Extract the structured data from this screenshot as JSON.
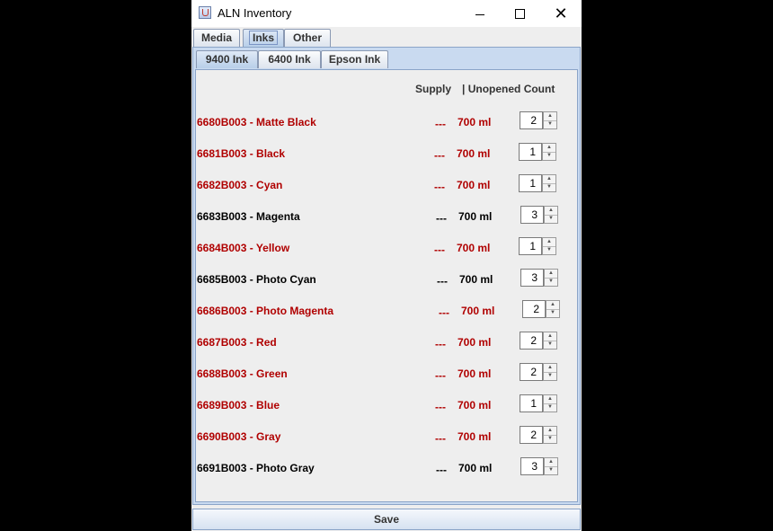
{
  "window": {
    "title": "ALN Inventory",
    "min_icon": "minimize-icon",
    "max_icon": "maximize-icon",
    "close_glyph": "✕"
  },
  "top_tabs": [
    {
      "label": "Media"
    },
    {
      "label": "Inks",
      "selected": true
    },
    {
      "label": "Other"
    }
  ],
  "sub_tabs": [
    {
      "label": "9400 Ink",
      "selected": true
    },
    {
      "label": "6400 Ink"
    },
    {
      "label": "Epson Ink"
    }
  ],
  "headers": {
    "supply": "Supply",
    "count": "| Unopened Count"
  },
  "rows": [
    {
      "name": "6680B003 - Matte Black",
      "supply": "---",
      "volume": "700 ml",
      "count": "2",
      "status": "low"
    },
    {
      "name": "6681B003 - Black",
      "supply": "---",
      "volume": "700 ml",
      "count": "1",
      "status": "low"
    },
    {
      "name": "6682B003 - Cyan",
      "supply": "---",
      "volume": "700 ml",
      "count": "1",
      "status": "low"
    },
    {
      "name": "6683B003 - Magenta",
      "supply": "---",
      "volume": "700 ml",
      "count": "3",
      "status": "ok"
    },
    {
      "name": "6684B003 - Yellow",
      "supply": "---",
      "volume": "700 ml",
      "count": "1",
      "status": "low"
    },
    {
      "name": "6685B003 - Photo Cyan",
      "supply": "---",
      "volume": "700 ml",
      "count": "3",
      "status": "ok"
    },
    {
      "name": "6686B003 - Photo Magenta",
      "supply": "---",
      "volume": "700 ml",
      "count": "2",
      "status": "low"
    },
    {
      "name": "6687B003 - Red",
      "supply": "---",
      "volume": "700 ml",
      "count": "2",
      "status": "low"
    },
    {
      "name": "6688B003 - Green",
      "supply": "---",
      "volume": "700 ml",
      "count": "2",
      "status": "low"
    },
    {
      "name": "6689B003 - Blue",
      "supply": "---",
      "volume": "700 ml",
      "count": "1",
      "status": "low"
    },
    {
      "name": "6690B003 - Gray",
      "supply": "---",
      "volume": "700 ml",
      "count": "2",
      "status": "low"
    },
    {
      "name": "6691B003 - Photo Gray",
      "supply": "---",
      "volume": "700 ml",
      "count": "3",
      "status": "ok"
    }
  ],
  "colors": {
    "low": "#b00000",
    "ok": "#000000"
  },
  "save_label": "Save"
}
